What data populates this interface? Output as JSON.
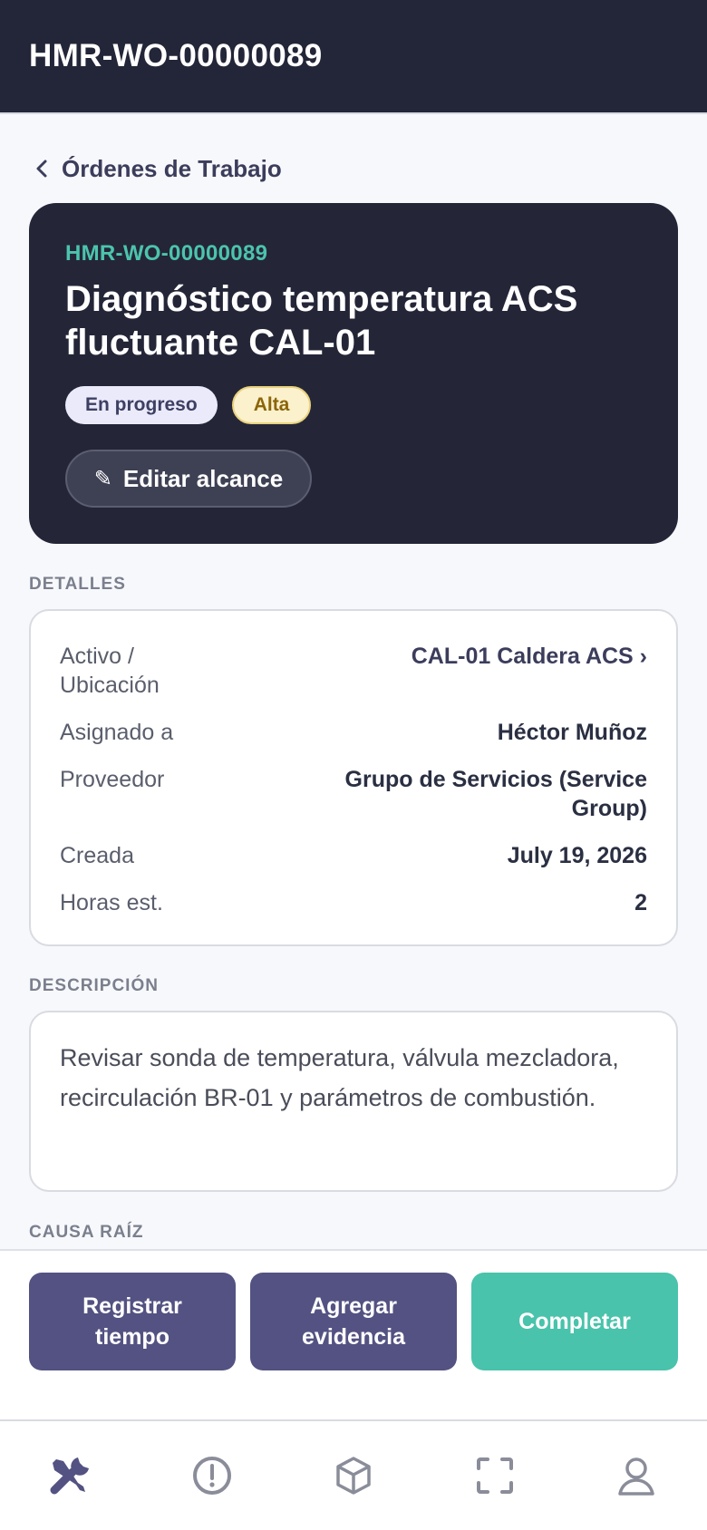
{
  "header": {
    "title": "HMR-WO-00000089"
  },
  "nav_back": {
    "label": "Órdenes de Trabajo"
  },
  "work_order": {
    "code": "HMR-WO-00000089",
    "title": "Diagnóstico temperatura ACS fluctuante CAL-01",
    "status": "En progreso",
    "priority": "Alta",
    "edit_label": "Editar alcance",
    "edit_icon": "✎"
  },
  "details": {
    "section_label": "DETALLES",
    "rows": [
      {
        "key": "Activo / Ubicación",
        "value": "CAL-01 Caldera ACS ›"
      },
      {
        "key": "Asignado a",
        "value": "Héctor Muñoz"
      },
      {
        "key": "Proveedor",
        "value": "Grupo de Servicios (Service Group)"
      },
      {
        "key": "Creada",
        "value": "July 19, 2026"
      },
      {
        "key": "Horas est.",
        "value": "2"
      }
    ]
  },
  "description": {
    "section_label": "DESCRIPCIÓN",
    "text": "Revisar sonda de temperatura, válvula mezcladora, recirculación BR-01 y parámetros de combustión."
  },
  "root_cause": {
    "section_label": "CAUSA RAÍZ"
  },
  "actions": {
    "log_time": "Registrar tiempo",
    "add_evidence": "Agregar evidencia",
    "complete": "Completar"
  },
  "bottom_nav": {
    "items": [
      "tools-icon",
      "alert-circle-icon",
      "box-icon",
      "scan-icon",
      "user-icon"
    ],
    "active": "tools-icon"
  },
  "colors": {
    "header_bg": "#232538",
    "accent_teal": "#49c3ab",
    "primary_purple": "#535282"
  }
}
